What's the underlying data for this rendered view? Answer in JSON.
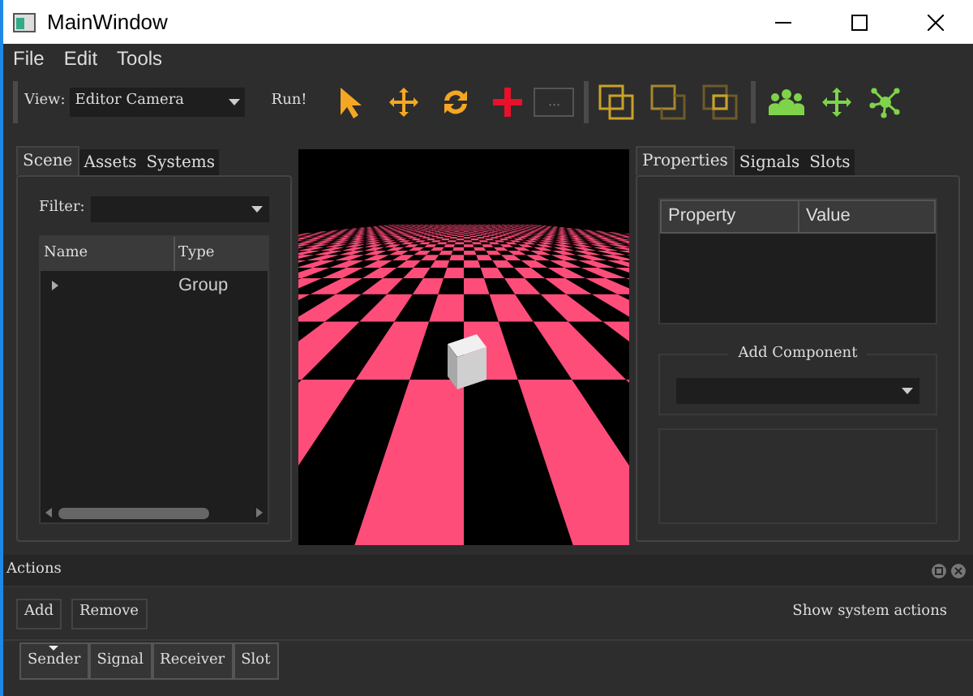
{
  "window": {
    "title": "MainWindow"
  },
  "menu": [
    "File",
    "Edit",
    "Tools"
  ],
  "toolbar": {
    "view_label": "View:",
    "view_value": "Editor Camera",
    "run_label": "Run!",
    "more_button": "..."
  },
  "left_panel": {
    "tabs": [
      {
        "label": "Scene",
        "selected": true
      },
      {
        "label": "Assets",
        "selected": false
      },
      {
        "label": "Systems",
        "selected": false
      }
    ],
    "filter_label": "Filter:",
    "columns": [
      "Name",
      "Type"
    ],
    "rows": [
      {
        "name": "",
        "type": "Group",
        "expanded": false
      }
    ]
  },
  "right_panel": {
    "tabs": [
      {
        "label": "Properties",
        "selected": true
      },
      {
        "label": "Signals",
        "selected": false
      },
      {
        "label": "Slots",
        "selected": false
      }
    ],
    "columns": [
      "Property",
      "Value"
    ],
    "add_component_label": "Add Component"
  },
  "actions_dock": {
    "title": "Actions",
    "buttons": [
      "Add",
      "Remove"
    ],
    "show_system_actions": "Show system actions",
    "columns": [
      {
        "label": "Sender",
        "sorted": true
      },
      {
        "label": "Signal",
        "sorted": false
      },
      {
        "label": "Receiver",
        "sorted": false
      },
      {
        "label": "Slot",
        "sorted": false
      }
    ]
  }
}
